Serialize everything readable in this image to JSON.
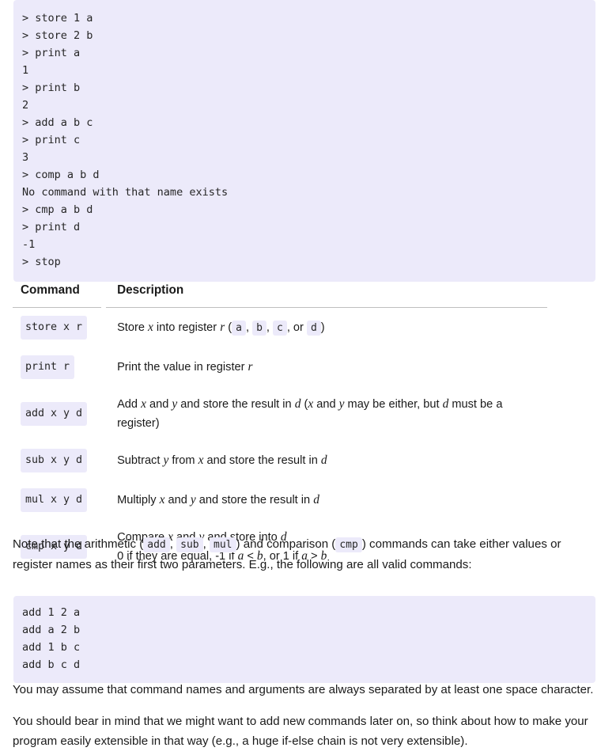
{
  "colors": {
    "code_background": "#eceafa",
    "text": "#1a1a1a",
    "code_text": "#262626",
    "table_rule": "#bfbfbf",
    "page_background": "#ffffff"
  },
  "terminal_transcript": {
    "name": "terminal-transcript",
    "lines": [
      "> store 1 a",
      "> store 2 b",
      "> print a",
      "1",
      "> print b",
      "2",
      "> add a b c",
      "> print c",
      "3",
      "> comp a b d",
      "No command with that name exists",
      "> cmp a b d",
      "> print d",
      "-1",
      "> stop"
    ]
  },
  "command_table": {
    "headers": {
      "command": "Command",
      "description": "Description"
    },
    "rows": [
      {
        "command": "store x r",
        "description_parts": [
          {
            "type": "text",
            "text": "Store "
          },
          {
            "type": "var",
            "text": "x"
          },
          {
            "type": "text",
            "text": " into register "
          },
          {
            "type": "var",
            "text": "r"
          },
          {
            "type": "text",
            "text": " ("
          },
          {
            "type": "code",
            "text": "a"
          },
          {
            "type": "text",
            "text": ", "
          },
          {
            "type": "code",
            "text": "b"
          },
          {
            "type": "text",
            "text": ", "
          },
          {
            "type": "code",
            "text": "c"
          },
          {
            "type": "text",
            "text": ", or "
          },
          {
            "type": "code",
            "text": "d"
          },
          {
            "type": "text",
            "text": ")"
          }
        ],
        "description_plain": "Store x into register r (a, b, c, or d)"
      },
      {
        "command": "print r",
        "description_parts": [
          {
            "type": "text",
            "text": "Print the value in register "
          },
          {
            "type": "var",
            "text": "r"
          }
        ],
        "description_plain": "Print the value in register r"
      },
      {
        "command": "add x y d",
        "description_parts": [
          {
            "type": "text",
            "text": "Add "
          },
          {
            "type": "var",
            "text": "x"
          },
          {
            "type": "text",
            "text": " and "
          },
          {
            "type": "var",
            "text": "y"
          },
          {
            "type": "text",
            "text": " and store the result in "
          },
          {
            "type": "var",
            "text": "d"
          },
          {
            "type": "text",
            "text": " ("
          },
          {
            "type": "var",
            "text": "x"
          },
          {
            "type": "text",
            "text": " and "
          },
          {
            "type": "var",
            "text": "y"
          },
          {
            "type": "text",
            "text": " may be either, but "
          },
          {
            "type": "var",
            "text": "d"
          },
          {
            "type": "text",
            "text": " must be a register)"
          }
        ],
        "description_plain": "Add x and y and store the result in d (x and y may be either, but d must be a register)"
      },
      {
        "command": "sub x y d",
        "description_parts": [
          {
            "type": "text",
            "text": "Subtract "
          },
          {
            "type": "var",
            "text": "y"
          },
          {
            "type": "text",
            "text": " from "
          },
          {
            "type": "var",
            "text": "x"
          },
          {
            "type": "text",
            "text": " and store the result in "
          },
          {
            "type": "var",
            "text": "d"
          }
        ],
        "description_plain": "Subtract y from x and store the result in d"
      },
      {
        "command": "mul x y d",
        "description_parts": [
          {
            "type": "text",
            "text": "Multiply "
          },
          {
            "type": "var",
            "text": "x"
          },
          {
            "type": "text",
            "text": " and "
          },
          {
            "type": "var",
            "text": "y"
          },
          {
            "type": "text",
            "text": " and store the result in "
          },
          {
            "type": "var",
            "text": "d"
          }
        ],
        "description_plain": "Multiply x and y and store the result in d"
      },
      {
        "command": "cmp x y d",
        "description_parts": [
          {
            "type": "text",
            "text": "Compare "
          },
          {
            "type": "var",
            "text": "x"
          },
          {
            "type": "text",
            "text": " and "
          },
          {
            "type": "var",
            "text": "y"
          },
          {
            "type": "text",
            "text": " and store into "
          },
          {
            "type": "var",
            "text": "d"
          },
          {
            "type": "break"
          },
          {
            "type": "text",
            "text": "0 if they are equal, -1 if "
          },
          {
            "type": "var",
            "text": "a"
          },
          {
            "type": "text",
            "text": " < "
          },
          {
            "type": "var",
            "text": "b"
          },
          {
            "type": "text",
            "text": ", or 1 if "
          },
          {
            "type": "var",
            "text": "a"
          },
          {
            "type": "text",
            "text": " > "
          },
          {
            "type": "var",
            "text": "b"
          }
        ],
        "description_plain": "Compare x and y and store into d / 0 if they are equal, -1 if a < b, or 1 if a > b"
      }
    ]
  },
  "note_paragraph": {
    "parts": [
      {
        "type": "text",
        "text": "Note that the arithmetic ("
      },
      {
        "type": "code",
        "text": "add"
      },
      {
        "type": "text",
        "text": ", "
      },
      {
        "type": "code",
        "text": "sub"
      },
      {
        "type": "text",
        "text": ", "
      },
      {
        "type": "code",
        "text": "mul"
      },
      {
        "type": "text",
        "text": ") and comparison ("
      },
      {
        "type": "code",
        "text": "cmp"
      },
      {
        "type": "text",
        "text": ") commands can take either values or register names as their first two parameters. E.g., the following are all valid commands:"
      }
    ],
    "plain": "Note that the arithmetic (add, sub, mul) and comparison (cmp) commands can take either values or register names as their first two parameters. E.g., the following are all valid commands:"
  },
  "example_commands": {
    "name": "example-commands",
    "lines": [
      "add 1 2 a",
      "add a 2 b",
      "add 1 b c",
      "add b c d"
    ]
  },
  "space_paragraph": {
    "text": "You may assume that command names and arguments are always separated by at least one space character."
  },
  "extensible_paragraph": {
    "text": "You should bear in mind that we might want to add new commands later on, so think about how to make your program easily extensible in that way (e.g., a huge if-else chain is not very extensible)."
  }
}
